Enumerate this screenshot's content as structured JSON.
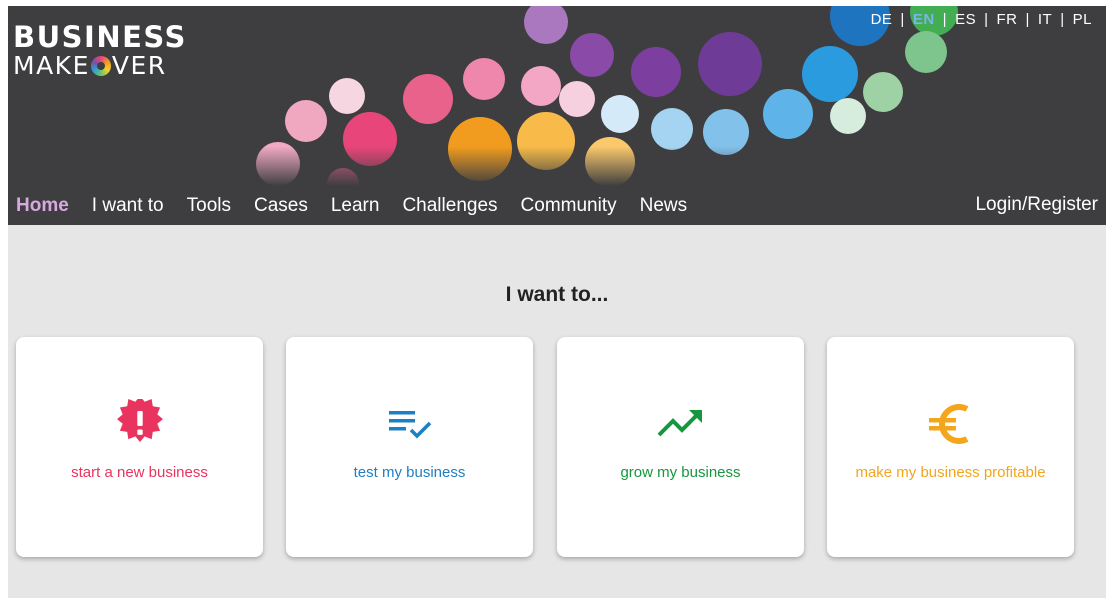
{
  "logo": {
    "line1": "BUSINESS",
    "line2_pre": "MAKE",
    "line2_post": "VER"
  },
  "languages": [
    {
      "code": "DE",
      "active": false
    },
    {
      "code": "EN",
      "active": true
    },
    {
      "code": "ES",
      "active": false
    },
    {
      "code": "FR",
      "active": false
    },
    {
      "code": "IT",
      "active": false
    },
    {
      "code": "PL",
      "active": false
    }
  ],
  "nav": {
    "items": [
      "Home",
      "I want to",
      "Tools",
      "Cases",
      "Learn",
      "Challenges",
      "Community",
      "News"
    ],
    "login": "Login/Register"
  },
  "main": {
    "heading": "I want to...",
    "cards": [
      {
        "label": "start a new business",
        "icon": "alert-badge-icon",
        "color": "#e8345f"
      },
      {
        "label": "test my business",
        "icon": "list-check-icon",
        "color": "#1e7fc2"
      },
      {
        "label": "grow my business",
        "icon": "trending-up-icon",
        "color": "#16963e"
      },
      {
        "label": "make my business profitable",
        "icon": "euro-icon",
        "color": "#f3a51b"
      }
    ]
  },
  "colors": {
    "header_bg": "#3e3e40",
    "nav_active": "#d6a9df",
    "page_bg": "#e6e6e6"
  }
}
